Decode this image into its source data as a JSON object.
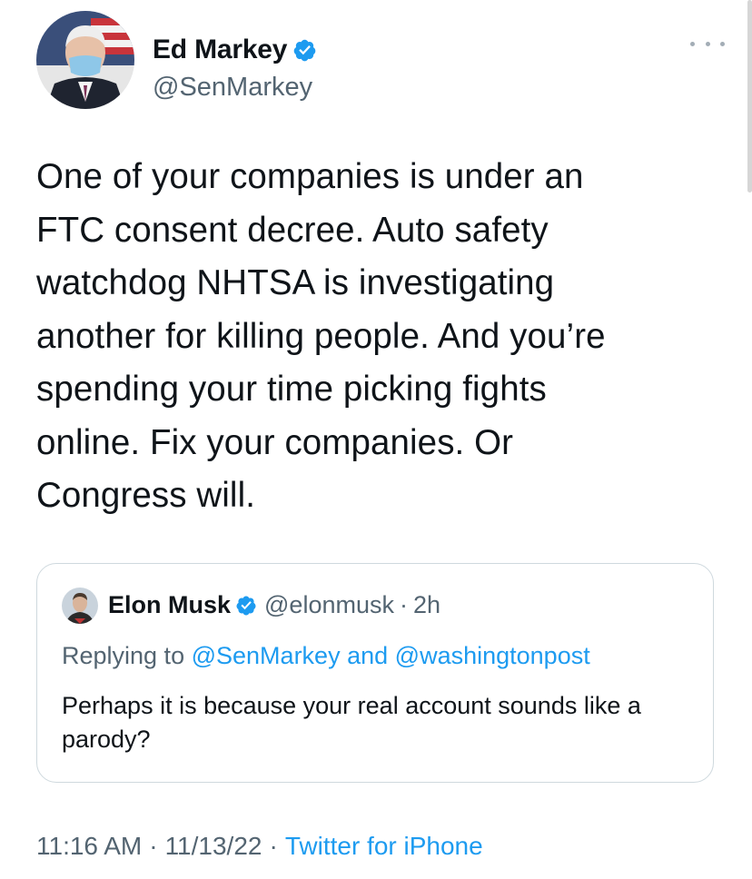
{
  "tweet": {
    "author_name": "Ed Markey",
    "author_handle": "@SenMarkey",
    "text": "One of your companies is under an\nFTC consent decree. Auto safety\nwatchdog NHTSA is investigating\nanother for killing people. And you’re\nspending your time picking fights\nonline. Fix your companies. Or\nCongress will.",
    "time": "11:16 AM",
    "date": "11/13/22",
    "source": "Twitter for iPhone",
    "separator": "·"
  },
  "quote": {
    "author_name": "Elon Musk",
    "author_handle": "@elonmusk",
    "time_ago": "2h",
    "separator": "·",
    "replying_prefix": "Replying to",
    "reply_to_1": "@SenMarkey",
    "reply_and": "and",
    "reply_to_2": "@washingtonpost",
    "text": "Perhaps it is because your real account sounds like a parody?"
  },
  "icons": {
    "verified": "verified-badge-icon",
    "more": "more-options-icon"
  },
  "colors": {
    "link_blue": "#1d9bf0",
    "secondary_text": "#536471",
    "primary_text": "#0f1419",
    "border": "#cfd9de"
  }
}
